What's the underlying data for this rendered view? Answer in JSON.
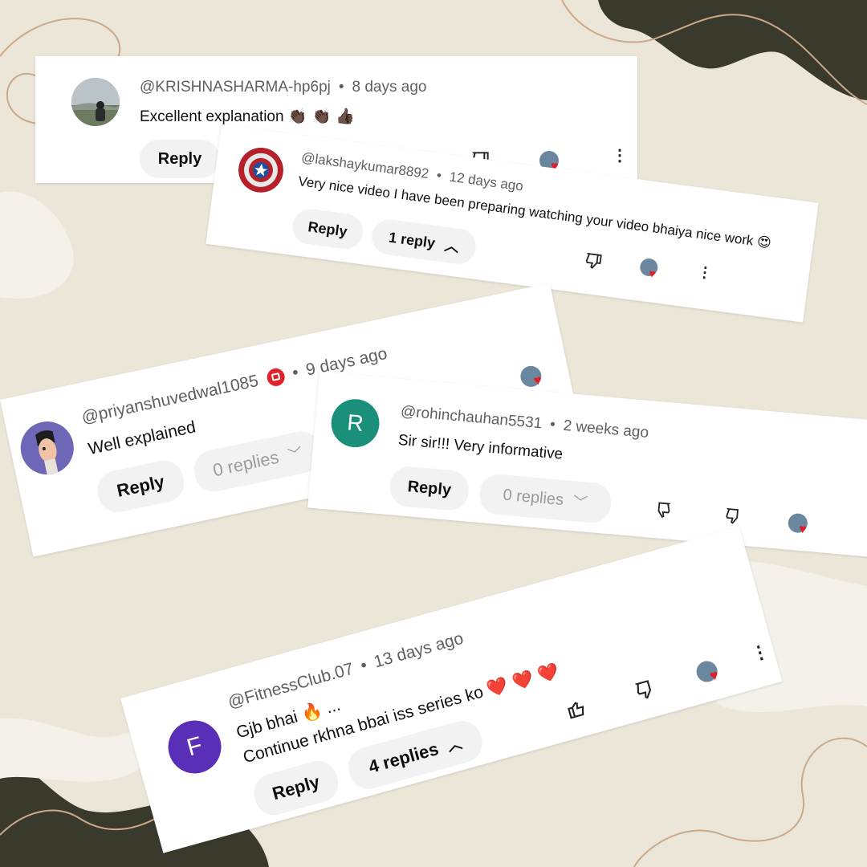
{
  "colors": {
    "background": "#ebe6d8",
    "blob_dark": "#3a3a2c",
    "line_tan": "#c9a98a",
    "heart": "#e01e2b",
    "muted_text": "#5f5f5f",
    "pill_bg": "#f2f2f2"
  },
  "comments": [
    {
      "handle": "@KRISHNASHARMA-hp6pj",
      "time": "8 days ago",
      "text": "Excellent explanation",
      "emoji": "👏🏿 👏🏿 👍🏿",
      "reply_label": "Reply",
      "avatar": "photo-avatar",
      "actions": [
        "like-icon",
        "dislike-icon",
        "creator-heart",
        "more-icon"
      ]
    },
    {
      "handle": "@lakshaykumar8892",
      "time": "12 days ago",
      "text": "Very nice video I have been preparing watching your video bhaiya nice work",
      "emoji": "😍",
      "reply_label": "Reply",
      "replies_label": "1 reply",
      "replies_chevron": "chevron-up-icon",
      "avatar": "shield-avatar"
    },
    {
      "handle": "@priyanshuvedwal1085",
      "time": "9 days ago",
      "text": "Well explained",
      "reply_label": "Reply",
      "replies_label": "0 replies",
      "replies_chevron": "chevron-down-icon",
      "badge": "member-badge-icon",
      "avatar": "cartoon-avatar"
    },
    {
      "handle": "@rohinchauhan5531",
      "time": "2 weeks ago",
      "text": "Sir sir!!! Very informative",
      "reply_label": "Reply",
      "replies_label": "0 replies",
      "replies_chevron": "chevron-down-icon",
      "avatar_letter": "R",
      "avatar_color": "#1a8f7a"
    },
    {
      "handle": "@FitnessClub.07",
      "time": "13 days ago",
      "text_line1": "Gjb bhai",
      "text_line1_emoji": "🔥",
      "text_line1_suffix": "...",
      "text_line2": "Continue rkhna bbai iss series ko",
      "text_line2_emoji": "❤️ ❤️ ❤️",
      "reply_label": "Reply",
      "replies_label": "4 replies",
      "replies_chevron": "chevron-up-icon",
      "avatar_letter": "F",
      "avatar_color": "#5a2fb8"
    }
  ]
}
